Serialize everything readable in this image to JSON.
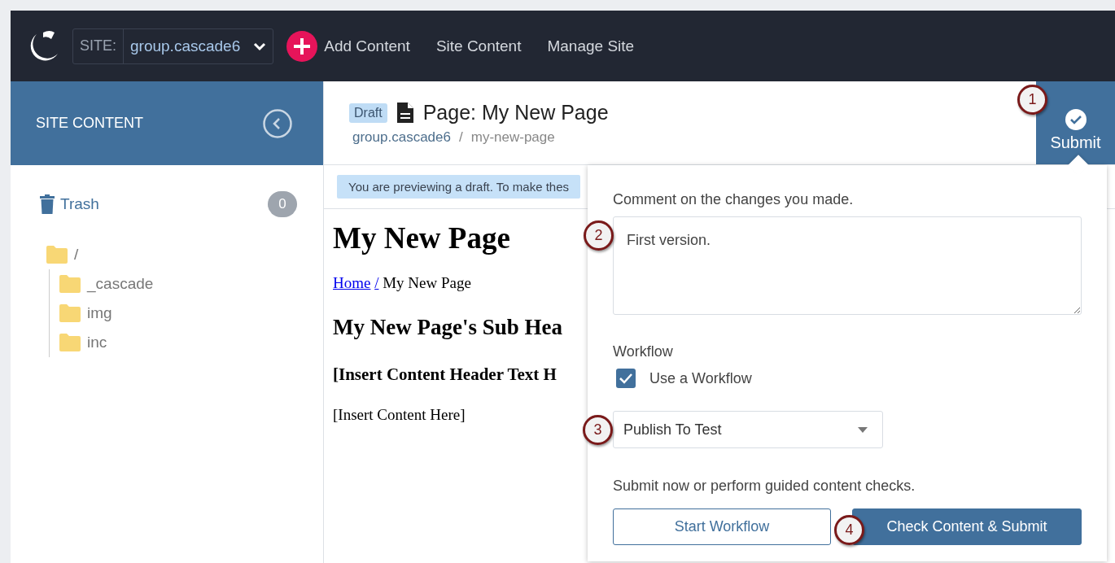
{
  "topbar": {
    "site_label": "SITE:",
    "site_value": "group.cascade6",
    "nav": [
      {
        "label": "Add Content",
        "kind": "add"
      },
      {
        "label": "Site Content",
        "kind": "link"
      },
      {
        "label": "Manage Site",
        "kind": "link"
      }
    ]
  },
  "sidebar": {
    "title": "SITE CONTENT",
    "trash": {
      "label": "Trash",
      "count": "0"
    },
    "tree": [
      {
        "label": "/",
        "children": [
          {
            "label": "_cascade"
          },
          {
            "label": "img"
          },
          {
            "label": "inc"
          }
        ]
      }
    ]
  },
  "page_header": {
    "status": "Draft",
    "title": "Page: My New Page",
    "breadcrumb": [
      {
        "label": "group.cascade6",
        "kind": "link"
      },
      {
        "label": "my-new-page",
        "kind": "current"
      }
    ],
    "separator": "/",
    "submit": "Submit"
  },
  "preview": {
    "notice": "You are previewing a draft. To make thes",
    "heading": "My New Page",
    "breadcrumb": [
      {
        "label": "Home",
        "kind": "link"
      },
      {
        "label": "/",
        "kind": "link"
      },
      {
        "label": "My New Page",
        "kind": "text"
      }
    ],
    "subheading": "My New Page's Sub Hea",
    "content_header": "[Insert Content Header Text H",
    "content": "[Insert Content Here]"
  },
  "submit_panel": {
    "comment_label": "Comment on the changes you made.",
    "comment": "First version.",
    "workflow_label": "Workflow",
    "use_workflow": {
      "label": "Use a Workflow",
      "checked": true
    },
    "workflow": "Publish To Test",
    "hint": "Submit now or perform guided content checks.",
    "buttons": [
      {
        "label": "Start Workflow",
        "kind": "secondary"
      },
      {
        "label": "Check Content & Submit",
        "kind": "primary"
      }
    ]
  },
  "callouts": [
    "1",
    "2",
    "3",
    "4"
  ]
}
